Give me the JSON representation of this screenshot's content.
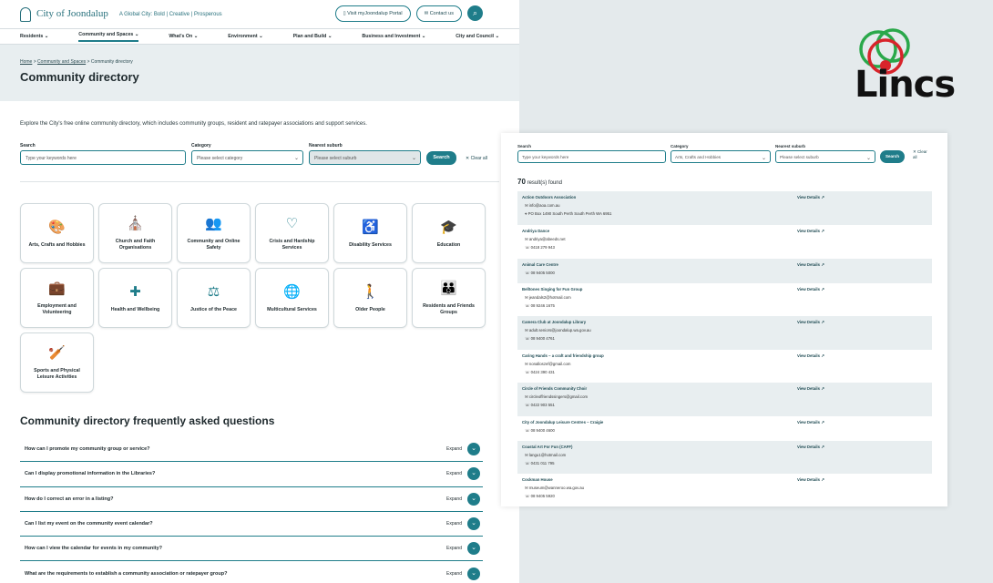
{
  "left": {
    "logo": {
      "name": "City of Joondalup",
      "tagline": "A Global City: Bold | Creative | Prosperous"
    },
    "header_buttons": [
      "Visit myJoondalup Portal",
      "Contact us"
    ],
    "nav": [
      "Residents",
      "Community and Spaces",
      "What's On",
      "Environment",
      "Plan and Build",
      "Business and Investment",
      "City and Council"
    ],
    "breadcrumb": {
      "home": "Home",
      "section": "Community and Spaces",
      "current": "Community directory"
    },
    "title": "Community directory",
    "intro": "Explore the City's free online community directory, which includes community groups, resident and ratepayer associations and support services.",
    "filters": {
      "search_label": "Search",
      "search_placeholder": "Type your keywords here",
      "category_label": "Category",
      "category_value": "Please select category",
      "suburb_label": "Nearest suburb",
      "suburb_value": "Please select suburb",
      "search_button": "Search",
      "clear": "Clear all"
    },
    "categories": [
      {
        "label": "Arts, Crafts and Hobbies",
        "icon": "palette-icon",
        "glyph": "🎨"
      },
      {
        "label": "Church and Faith Organisations",
        "icon": "church-icon",
        "glyph": "⛪"
      },
      {
        "label": "Community and Online Safety",
        "icon": "people-group-icon",
        "glyph": "👥"
      },
      {
        "label": "Crisis and Hardship Services",
        "icon": "heart-hands-icon",
        "glyph": "♡"
      },
      {
        "label": "Disability Services",
        "icon": "wheelchair-icon",
        "glyph": "♿"
      },
      {
        "label": "Education",
        "icon": "graduation-cap-icon",
        "glyph": "🎓"
      },
      {
        "label": "Employment and Volunteering",
        "icon": "briefcase-icon",
        "glyph": "💼"
      },
      {
        "label": "Health and Wellbeing",
        "icon": "health-house-icon",
        "glyph": "✚"
      },
      {
        "label": "Justice of the Peace",
        "icon": "scales-icon",
        "glyph": "⚖"
      },
      {
        "label": "Multicultural Services",
        "icon": "globe-icon",
        "glyph": "🌐"
      },
      {
        "label": "Older People",
        "icon": "elderly-person-icon",
        "glyph": "🚶"
      },
      {
        "label": "Residents and Friends Groups",
        "icon": "group-icon",
        "glyph": "👪"
      },
      {
        "label": "Sports and Physical Leisure Activities",
        "icon": "bat-ball-icon",
        "glyph": "🏏"
      }
    ],
    "faq_title": "Community directory frequently asked questions",
    "faq_expand": "Expand",
    "faqs": [
      "How can I promote my community group or service?",
      "Can I display promotional information in the Libraries?",
      "How do I correct an error in a listing?",
      "Can I list my event on the community event calendar?",
      "How can I view the calendar for events in my community?",
      "What are the requirements to establish a community association or ratepayer group?"
    ]
  },
  "right": {
    "filters": {
      "search_label": "Search",
      "search_placeholder": "Type your keywords here",
      "category_label": "Category",
      "category_value": "Arts, Crafts and Hobbies",
      "suburb_label": "Nearest suburb",
      "suburb_value": "Please select suburb",
      "search_button": "Search",
      "clear": "Clear all"
    },
    "count": "70",
    "count_label": "result(s) found",
    "view_details": "View Details",
    "results": [
      {
        "name": "Action Outdoors Association",
        "lines": [
          [
            "mail",
            "info@aoa.com.au"
          ],
          [
            "pin",
            "PO Box 1490 South Perth South Perth WA 6951"
          ]
        ]
      },
      {
        "name": "Andriya Dance",
        "lines": [
          [
            "mail",
            "andriya@abeeds.net"
          ],
          [
            "phone",
            "0418 279 943"
          ]
        ]
      },
      {
        "name": "Animal Care Centre",
        "lines": [
          [
            "phone",
            "08 9405 5000"
          ]
        ]
      },
      {
        "name": "Belltones Singing for Fun Group",
        "lines": [
          [
            "mail",
            "jeandals2@hotmail.com"
          ],
          [
            "phone",
            "08 9246 1675"
          ]
        ]
      },
      {
        "name": "Camera Club at Joondalup Library",
        "lines": [
          [
            "mail",
            "adult.seniors@joondalup.wa.gov.au"
          ],
          [
            "phone",
            "08 9400 4761"
          ]
        ]
      },
      {
        "name": "Caring Hands – a craft and friendship group",
        "lines": [
          [
            "mail",
            "nonalloszef@gmail.com"
          ],
          [
            "phone",
            "0424 390 431"
          ]
        ]
      },
      {
        "name": "Circle of Friends Community Choir",
        "lines": [
          [
            "mail",
            "circleoffriendssingers@gmail.com"
          ],
          [
            "phone",
            "0422 903 551"
          ]
        ]
      },
      {
        "name": "City of Joondalup Leisure Centres – Craigie",
        "lines": [
          [
            "phone",
            "08 9400 4600"
          ]
        ]
      },
      {
        "name": "Coastal Art For Fun (CAFF)",
        "lines": [
          [
            "mail",
            "langu1@hotmail.com"
          ],
          [
            "phone",
            "0431 011 795"
          ]
        ]
      },
      {
        "name": "Cockman House",
        "lines": [
          [
            "mail",
            "museum@wanneroo.wa.gov.au"
          ],
          [
            "phone",
            "08 9405 5920"
          ]
        ]
      }
    ]
  },
  "brand": {
    "name": "Lincs",
    "colors": {
      "green": "#2aa84a",
      "red": "#d8242b"
    }
  }
}
